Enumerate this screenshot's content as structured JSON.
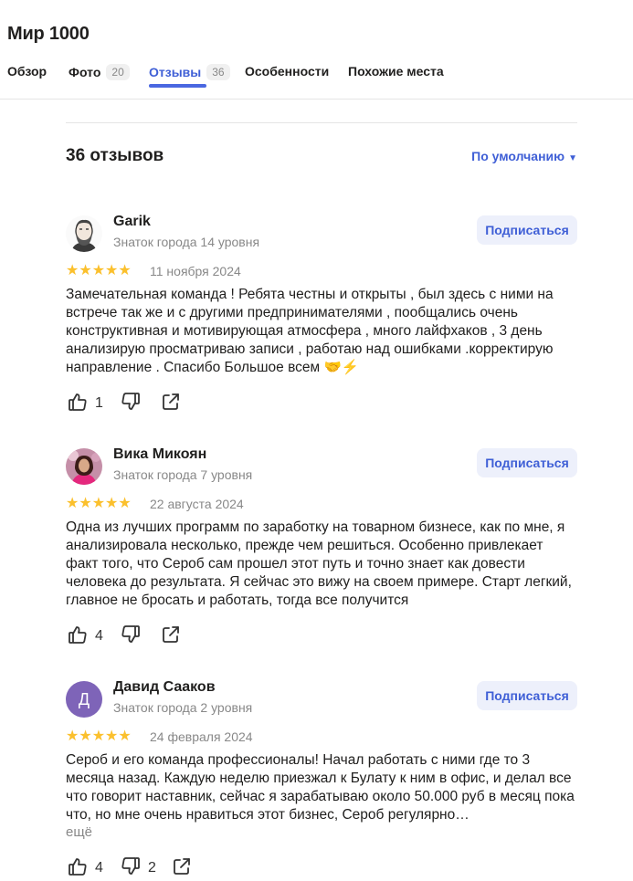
{
  "place": {
    "title": "Мир 1000"
  },
  "tabs": [
    {
      "label": "Обзор",
      "count": ""
    },
    {
      "label": "Фото",
      "count": "20"
    },
    {
      "label": "Отзывы",
      "count": "36"
    },
    {
      "label": "Особенности",
      "count": ""
    },
    {
      "label": "Похожие места",
      "count": ""
    }
  ],
  "reviews_header": {
    "count_title": "36 отзывов",
    "sort_label": "По умолчанию"
  },
  "colors": {
    "accent": "#4a67e1",
    "star": "#fbc02d",
    "avatar3_bg": "#7e64b8"
  },
  "reviews": [
    {
      "name": "Garik",
      "level": "Знаток города 14 уровня",
      "rating": 5,
      "date": "11 ноября 2024",
      "text": "Замечательная команда ! Ребята честны и открыты , был здесь с ними на встрече так же и с другими предпринимателями , пообщались очень конструктивная и мотивирующая атмосфера , много лайфхаков ,  3 день анализирую просматриваю записи , работаю над ошибками .корректирую направление . Спасибо Большое всем 🤝⚡",
      "likes": "1",
      "dislikes": "",
      "subscribe": "Подписаться",
      "avatar_icon": "bearded-man-avatar"
    },
    {
      "name": "Вика Микоян",
      "level": "Знаток города 7 уровня",
      "rating": 5,
      "date": "22 августа 2024",
      "text": "Одна из лучших программ по заработку на товарном бизнесе, как по мне, я анализировала несколько, прежде чем решиться. Особенно привлекает факт того, что Сероб сам прошел этот путь и точно знает как довести человека до результата. Я сейчас это вижу на своем примере. Старт легкий, главное не бросать и работать, тогда все получится",
      "likes": "4",
      "dislikes": "",
      "subscribe": "Подписаться",
      "avatar_icon": "woman-photo-avatar"
    },
    {
      "name": "Давид Сааков",
      "level": "Знаток города 2 уровня",
      "rating": 5,
      "date": "24 февраля 2024",
      "text": "Сероб и его команда профессионалы! Начал работать с ними где то 3 месяца назад. Каждую неделю приезжал к Булату к ним в офис, и делал все что говорит наставник, сейчас я зарабатываю около 50.000 руб в месяц пока что, но мне очень нравиться этот бизнес, Сероб регулярно…",
      "more": "ещё",
      "likes": "4",
      "dislikes": "2",
      "subscribe": "Подписаться",
      "avatar_letter": "Д"
    }
  ],
  "icons": {
    "like": "thumbs-up-icon",
    "dislike": "thumbs-down-icon",
    "share": "share-icon",
    "star": "star-icon",
    "sort": "caret-down-icon"
  }
}
